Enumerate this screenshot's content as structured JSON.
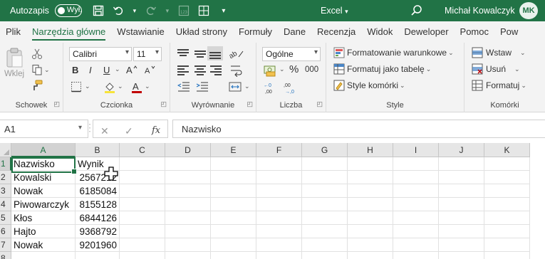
{
  "titlebar": {
    "autosave_label": "Autozapis",
    "autosave_state": "Wył.",
    "app_title": "Excel",
    "app_title_chevron": "▾",
    "user_name": "Michał Kowalczyk",
    "avatar_initials": "MK",
    "accent_color": "#217346"
  },
  "tabs": [
    "Plik",
    "Narzędzia główne",
    "Wstawianie",
    "Układ strony",
    "Formuły",
    "Dane",
    "Recenzja",
    "Widok",
    "Deweloper",
    "Pomoc",
    "Pow"
  ],
  "ribbon": {
    "clipboard": {
      "paste_label": "Wklej",
      "group_label": "Schowek"
    },
    "font": {
      "font_name": "Calibri",
      "font_size": "11",
      "bold": "B",
      "italic": "I",
      "underline": "U",
      "group_label": "Czcionka"
    },
    "alignment": {
      "group_label": "Wyrównanie"
    },
    "number": {
      "format": "Ogólne",
      "percent": "%",
      "thousands": "000",
      "group_label": "Liczba"
    },
    "styles": {
      "conditional": "Formatowanie warunkowe",
      "table": "Formatuj jako tabelę",
      "cell_styles": "Style komórki",
      "group_label": "Style"
    },
    "cells": {
      "insert": "Wstaw",
      "delete": "Usuń",
      "format": "Formatuj",
      "group_label": "Komórki"
    }
  },
  "formula_bar": {
    "name_box": "A1",
    "fx": "fx",
    "content": "Nazwisko"
  },
  "columns": [
    "A",
    "B",
    "C",
    "D",
    "E",
    "F",
    "G",
    "H",
    "I",
    "J",
    "K"
  ],
  "rows": [
    {
      "num": "1",
      "a": "Nazwisko",
      "b": "Wynik"
    },
    {
      "num": "2",
      "a": "Kowalski",
      "b": "2567212"
    },
    {
      "num": "3",
      "a": "Nowak",
      "b": "6185084"
    },
    {
      "num": "4",
      "a": "Piwowarczyk",
      "b": "8155128"
    },
    {
      "num": "5",
      "a": "Kłos",
      "b": "6844126"
    },
    {
      "num": "6",
      "a": "Hajto",
      "b": "9368792"
    },
    {
      "num": "7",
      "a": "Nowak",
      "b": "9201960"
    },
    {
      "num": "8",
      "a": "",
      "b": ""
    }
  ]
}
